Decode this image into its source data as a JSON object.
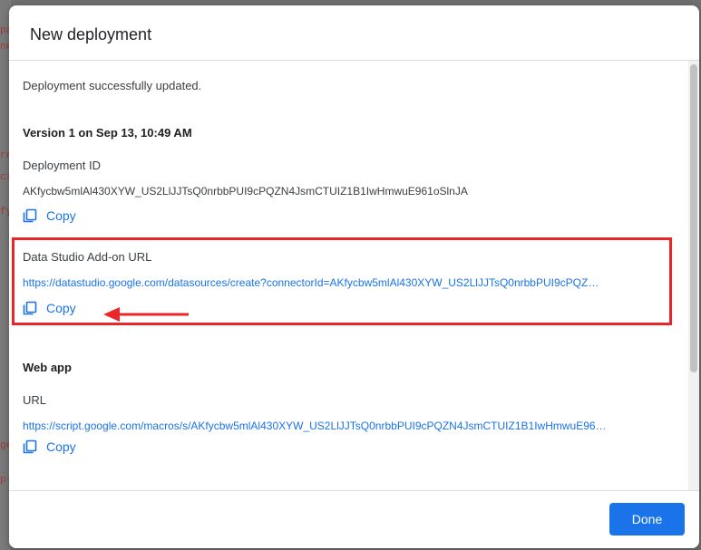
{
  "dialog": {
    "title": "New deployment",
    "message": "Deployment successfully updated.",
    "version_title": "Version 1 on Sep 13, 10:49 AM",
    "deployment_id": {
      "label": "Deployment ID",
      "value": "AKfycbw5mlAl430XYW_US2LlJJTsQ0nrbbPUI9cPQZN4JsmCTUIZ1B1IwHmwuE961oSlnJA",
      "copy_label": "Copy"
    },
    "addon_url": {
      "label": "Data Studio Add-on URL",
      "value": "https://datastudio.google.com/datasources/create?connectorId=AKfycbw5mlAl430XYW_US2LlJJTsQ0nrbbPUI9cPQZ…",
      "copy_label": "Copy"
    },
    "web_app": {
      "title": "Web app",
      "url_label": "URL",
      "url_value": "https://script.google.com/macros/s/AKfycbw5mlAl430XYW_US2LlJJTsQ0nrbbPUI9cPQZN4JsmCTUIZ1B1IwHmwuE96…",
      "copy_label": "Copy"
    },
    "done_label": "Done"
  },
  "colors": {
    "accent": "#1a73e8",
    "highlight": "#e8272b"
  },
  "backdrop_code": [
    "pa",
    "ne",
    "re",
    "ci",
    "fy",
    "ge",
    "p-"
  ]
}
